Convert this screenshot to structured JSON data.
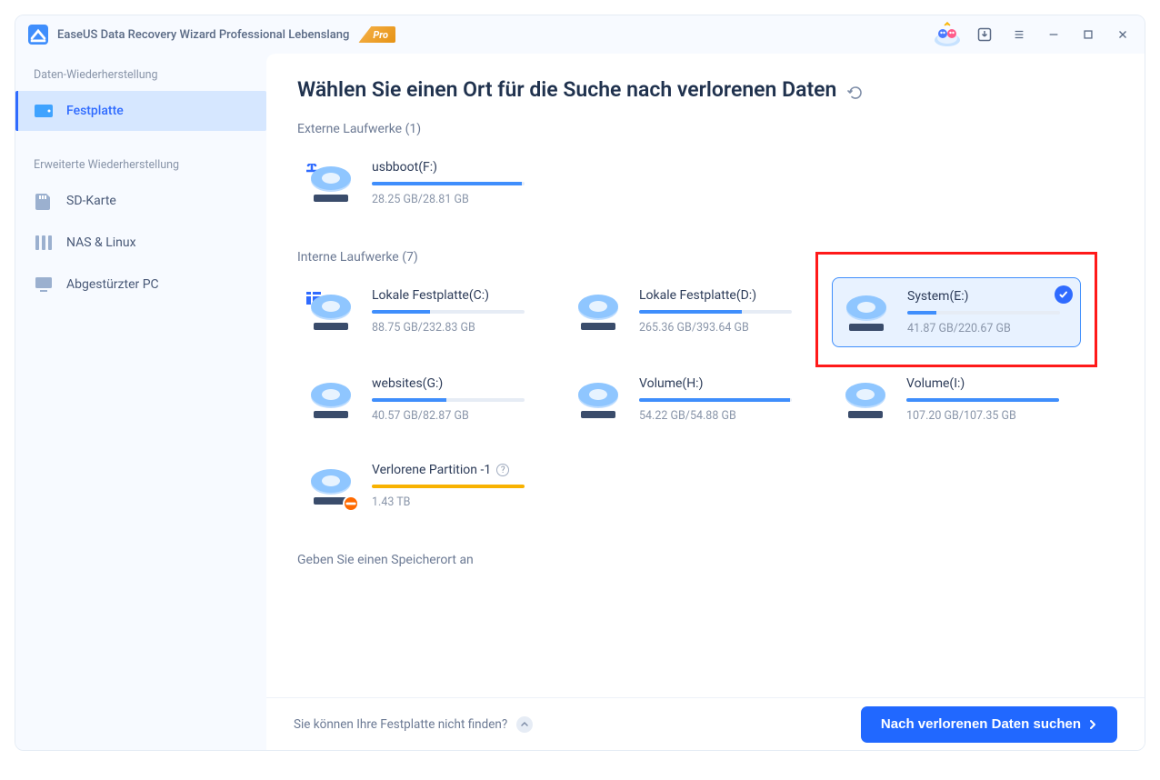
{
  "app": {
    "title": "EaseUS Data Recovery Wizard Professional Lebenslang",
    "badge": "Pro"
  },
  "sidebar": {
    "section1_label": "Daten-Wiederherstellung",
    "section1_items": [
      {
        "label": "Festplatte"
      }
    ],
    "section2_label": "Erweiterte Wiederherstellung",
    "section2_items": [
      {
        "label": "SD-Karte"
      },
      {
        "label": "NAS & Linux"
      },
      {
        "label": "Abgestürzter PC"
      }
    ]
  },
  "main": {
    "heading": "Wählen Sie einen Ort für die Suche nach verlorenen Daten",
    "external_label": "Externe Laufwerke (1)",
    "external_drives": [
      {
        "name": "usbboot(F:)",
        "size": "28.25 GB/28.81 GB",
        "fill_pct": 98,
        "type": "usb"
      }
    ],
    "internal_label": "Interne Laufwerke (7)",
    "internal_drives": [
      {
        "name": "Lokale Festplatte(C:)",
        "size": "88.75 GB/232.83 GB",
        "fill_pct": 38,
        "type": "windows"
      },
      {
        "name": "Lokale Festplatte(D:)",
        "size": "265.36 GB/393.64 GB",
        "fill_pct": 67,
        "type": "hdd"
      },
      {
        "name": "System(E:)",
        "size": "41.87 GB/220.67 GB",
        "fill_pct": 19,
        "type": "hdd",
        "selected": true,
        "highlighted": true
      },
      {
        "name": "websites(G:)",
        "size": "40.57 GB/82.87 GB",
        "fill_pct": 49,
        "type": "hdd"
      },
      {
        "name": "Volume(H:)",
        "size": "54.22 GB/54.88 GB",
        "fill_pct": 99,
        "type": "hdd"
      },
      {
        "name": "Volume(I:)",
        "size": "107.20 GB/107.35 GB",
        "fill_pct": 100,
        "type": "hdd"
      },
      {
        "name": "Verlorene Partition -1",
        "size": "1.43 TB",
        "fill_pct": 100,
        "type": "lost",
        "warn": true,
        "help": true
      }
    ],
    "specify_label": "Geben Sie einen Speicherort an"
  },
  "footer": {
    "hint": "Sie können Ihre Festplatte nicht finden?",
    "cta": "Nach verlorenen Daten suchen"
  }
}
